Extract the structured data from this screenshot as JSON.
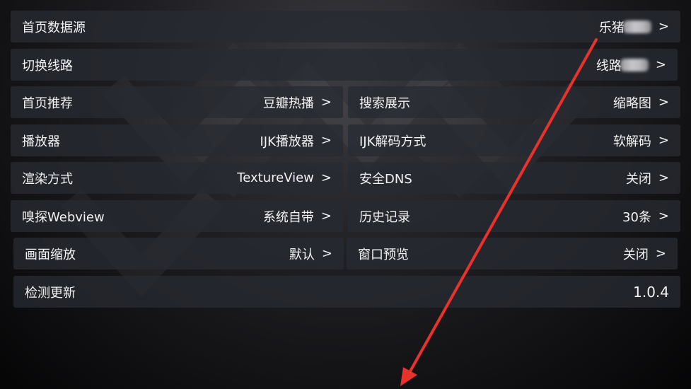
{
  "settings": {
    "home_source": {
      "label": "首页数据源",
      "value": "乐猪"
    },
    "switch_line": {
      "label": "切换线路",
      "value": "线路"
    },
    "home_recommend": {
      "label": "首页推荐",
      "value": "豆瓣热播"
    },
    "search_display": {
      "label": "搜索展示",
      "value": "缩略图"
    },
    "player": {
      "label": "播放器",
      "value": "IJK播放器"
    },
    "ijk_decode": {
      "label": "IJK解码方式",
      "value": "软解码"
    },
    "render_mode": {
      "label": "渲染方式",
      "value": "TextureView"
    },
    "secure_dns": {
      "label": "安全DNS",
      "value": "关闭"
    },
    "sniff_webview": {
      "label": "嗅探Webview",
      "value": "系统自带"
    },
    "history": {
      "label": "历史记录",
      "value": "30条"
    },
    "picture_scale": {
      "label": "画面缩放",
      "value": "默认"
    },
    "window_preview": {
      "label": "窗口预览",
      "value": "关闭"
    },
    "check_update": {
      "label": "检测更新",
      "value": "1.0.4"
    }
  },
  "chevron": ">",
  "colors": {
    "annotation_arrow": "#e8322b",
    "row_bg": "#282a32"
  }
}
